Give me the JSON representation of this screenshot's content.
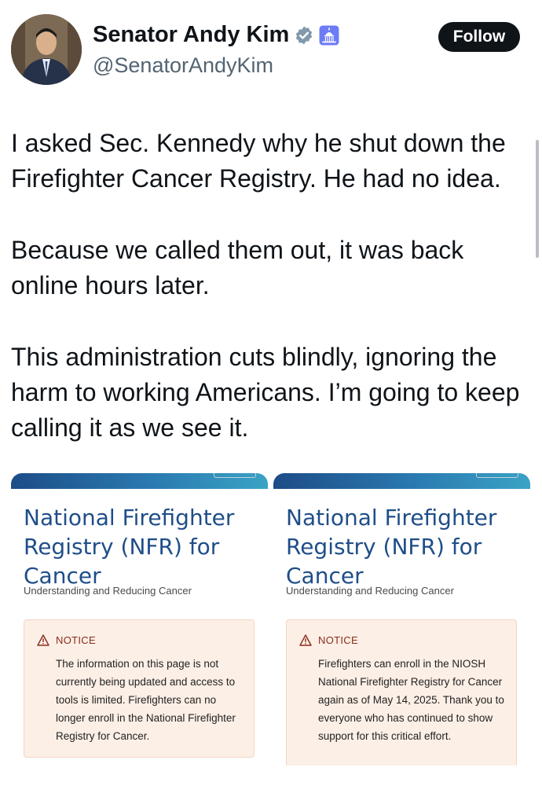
{
  "header": {
    "display_name": "Senator Andy Kim",
    "handle": "@SenatorAndyKim",
    "follow_label": "Follow",
    "verified_icon": "verified-badge-icon",
    "affiliation_icon": "capitol-building-icon"
  },
  "tweet": {
    "paragraphs": [
      "I asked Sec. Kennedy why he shut down the Firefighter Cancer Registry. He had no idea.",
      "Because we called them out, it was back online hours later.",
      "This administration cuts blindly, ignoring the harm to working Americans. I’m going to keep calling it as we see it."
    ]
  },
  "images": [
    {
      "title": "National Firefighter Registry (NFR) for Cancer",
      "subtitle": "Understanding and Reducing Cancer",
      "notice_label": "NOTICE",
      "notice_text": "The information on this page is not currently being updated and access to tools is limited. Firefighters can no longer enroll in the National Firefighter Registry for Cancer."
    },
    {
      "title": "National Firefighter Registry (NFR) for Cancer",
      "subtitle": "Understanding and Reducing Cancer",
      "notice_label": "NOTICE",
      "notice_text": "Firefighters can enroll in the NIOSH National Firefighter Registry for Cancer again as of May 14, 2025. Thank you to everyone who has continued to show support for this critical effort."
    }
  ],
  "colors": {
    "follow_bg": "#0f1419",
    "verified": "#829aab",
    "nfr_title": "#1f4e88",
    "notice_bg": "#fcefe6",
    "notice_label": "#8a2b1a"
  }
}
